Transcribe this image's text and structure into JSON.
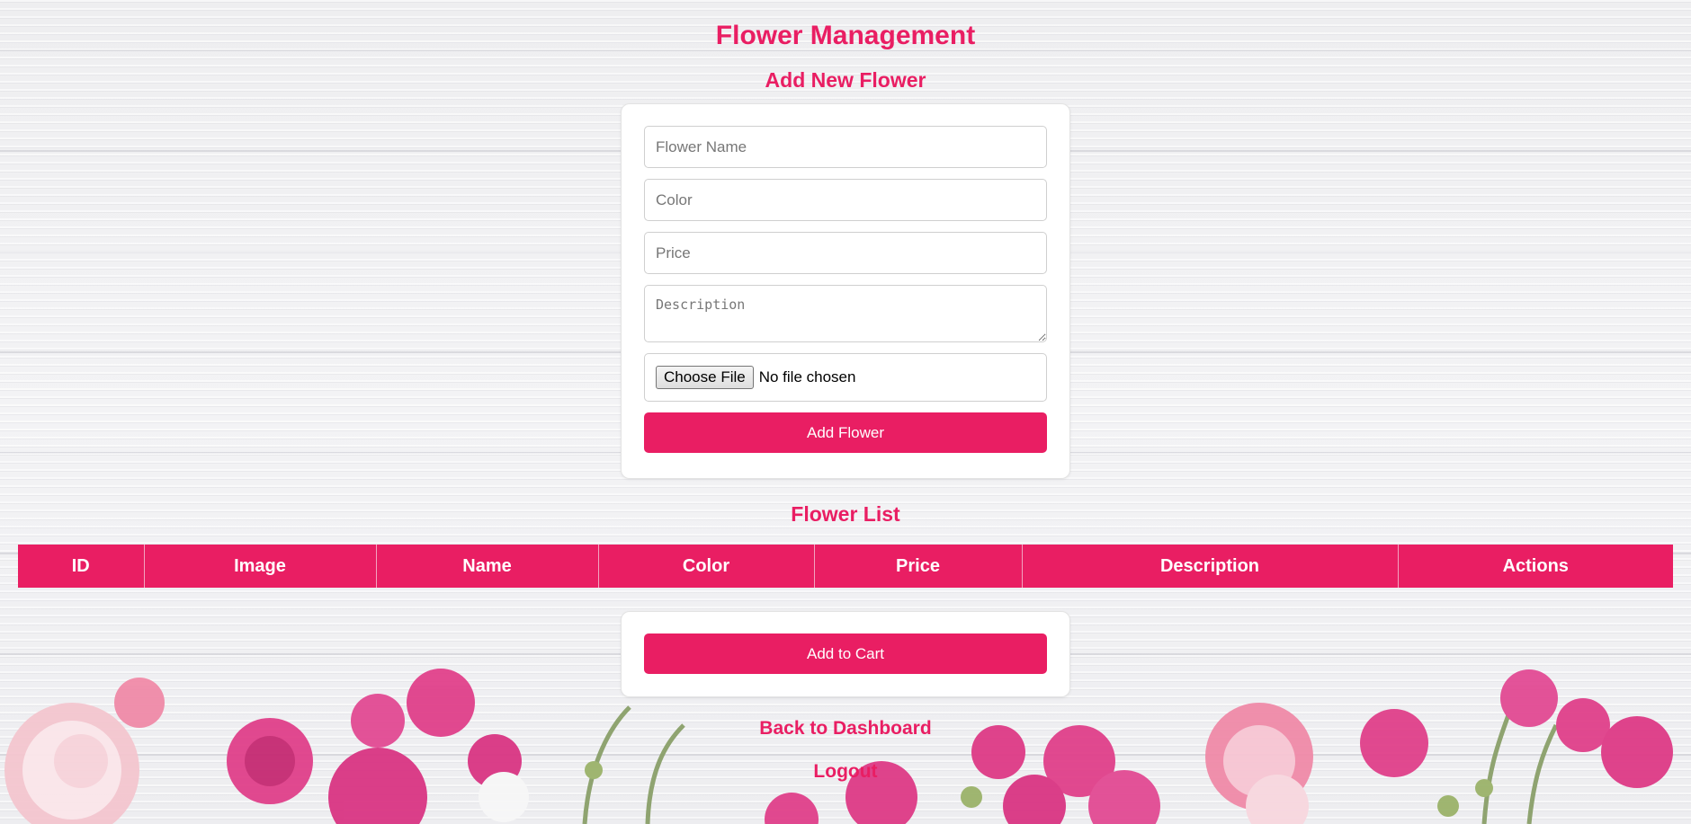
{
  "page": {
    "title": "Flower Management",
    "form_heading": "Add New Flower",
    "list_heading": "Flower List"
  },
  "form": {
    "name_placeholder": "Flower Name",
    "color_placeholder": "Color",
    "price_placeholder": "Price",
    "description_placeholder": "Description",
    "choose_file_label": "Choose File",
    "file_status": "No file chosen",
    "submit_label": "Add Flower"
  },
  "table": {
    "columns": [
      "ID",
      "Image",
      "Name",
      "Color",
      "Price",
      "Description",
      "Actions"
    ],
    "rows": []
  },
  "cart": {
    "add_to_cart_label": "Add to Cart"
  },
  "links": {
    "back": "Back to Dashboard",
    "logout": "Logout"
  },
  "colors": {
    "accent": "#e91e63",
    "background": "#ececee",
    "card": "#ffffff"
  }
}
